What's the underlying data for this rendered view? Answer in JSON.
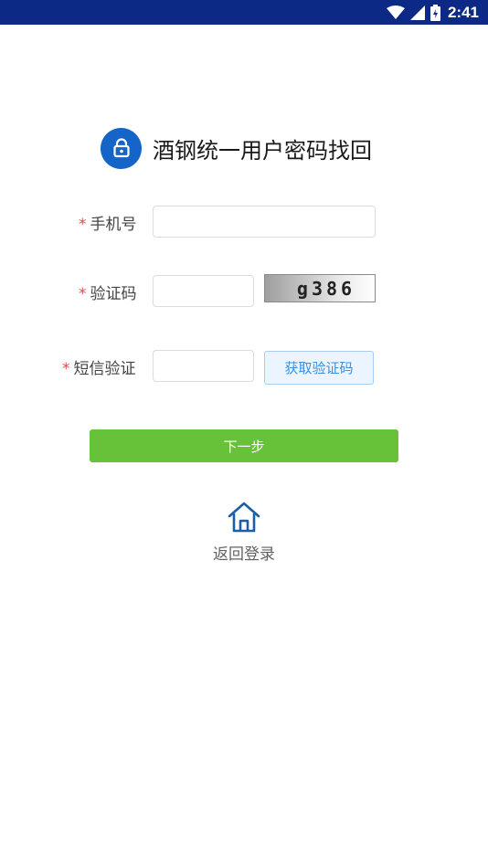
{
  "status_bar": {
    "time": "2:41",
    "icons": [
      "wifi-icon",
      "signal-icon",
      "battery-icon"
    ],
    "background": "#0c2a85"
  },
  "header": {
    "title": "酒钢统一用户密码找回",
    "icon": "unlock-icon",
    "icon_color": "#1565c8"
  },
  "form": {
    "required_mark": "*",
    "phone": {
      "label": "手机号",
      "value": "",
      "placeholder": ""
    },
    "captcha": {
      "label": "验证码",
      "value": "",
      "placeholder": "",
      "image_text": "g386"
    },
    "sms": {
      "label": "短信验证",
      "value": "",
      "placeholder": "",
      "button_label": "获取验证码"
    }
  },
  "actions": {
    "next_label": "下一步",
    "next_color": "#67c23a",
    "back_login_label": "返回登录",
    "back_login_icon": "home-icon"
  }
}
